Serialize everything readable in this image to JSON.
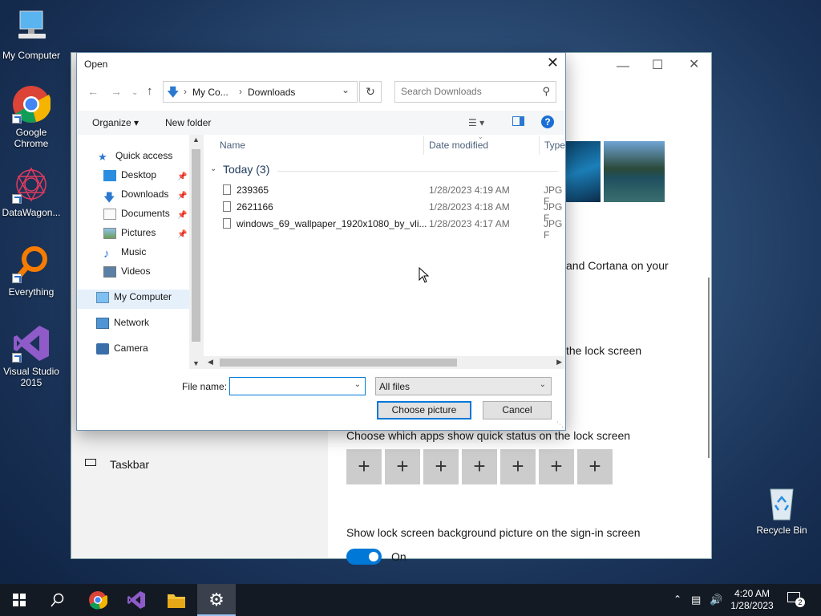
{
  "desktop": {
    "icons": [
      {
        "label": "My Computer",
        "icon": "computer-icon"
      },
      {
        "label": "Google Chrome",
        "icon": "chrome-icon"
      },
      {
        "label": "DataWagon...",
        "icon": "datawagon-icon"
      },
      {
        "label": "Everything",
        "icon": "everything-search-icon"
      },
      {
        "label": "Visual Studio 2015",
        "icon": "visual-studio-icon"
      },
      {
        "label": "Recycle Bin",
        "icon": "recycle-bin-icon"
      }
    ]
  },
  "settings": {
    "left_item": "Taskbar",
    "text_cortana": "and Cortana on your",
    "text_lock": "the lock screen",
    "quick_status_title": "Choose which apps show quick status on the lock screen",
    "quick_buttons": [
      "+",
      "+",
      "+",
      "+",
      "+",
      "+",
      "+"
    ],
    "signin_title": "Show lock screen background picture on the sign-in screen",
    "toggle_label": "On"
  },
  "dialog": {
    "title": "Open",
    "address": {
      "seg1": "My Co...",
      "seg2": "Downloads"
    },
    "search_placeholder": "Search Downloads",
    "organize": "Organize",
    "new_folder": "New folder",
    "nav": [
      {
        "label": "Quick access"
      },
      {
        "label": "Desktop"
      },
      {
        "label": "Downloads"
      },
      {
        "label": "Documents"
      },
      {
        "label": "Pictures"
      },
      {
        "label": "Music"
      },
      {
        "label": "Videos"
      },
      {
        "label": "My Computer"
      },
      {
        "label": "Network"
      },
      {
        "label": "Camera"
      }
    ],
    "columns": {
      "name": "Name",
      "date": "Date modified",
      "type": "Type"
    },
    "group": "Today (3)",
    "files": [
      {
        "name": "239365",
        "date": "1/28/2023 4:19 AM",
        "type": "JPG F"
      },
      {
        "name": "2621166",
        "date": "1/28/2023 4:18 AM",
        "type": "JPG F"
      },
      {
        "name": "windows_69_wallpaper_1920x1080_by_vli...",
        "date": "1/28/2023 4:17 AM",
        "type": "JPG F"
      }
    ],
    "file_name_label": "File name:",
    "file_name_value": "",
    "filter": "All files",
    "choose_button": "Choose picture",
    "cancel_button": "Cancel"
  },
  "taskbar": {
    "time": "4:20 AM",
    "date": "1/28/2023",
    "notification_count": "2"
  }
}
